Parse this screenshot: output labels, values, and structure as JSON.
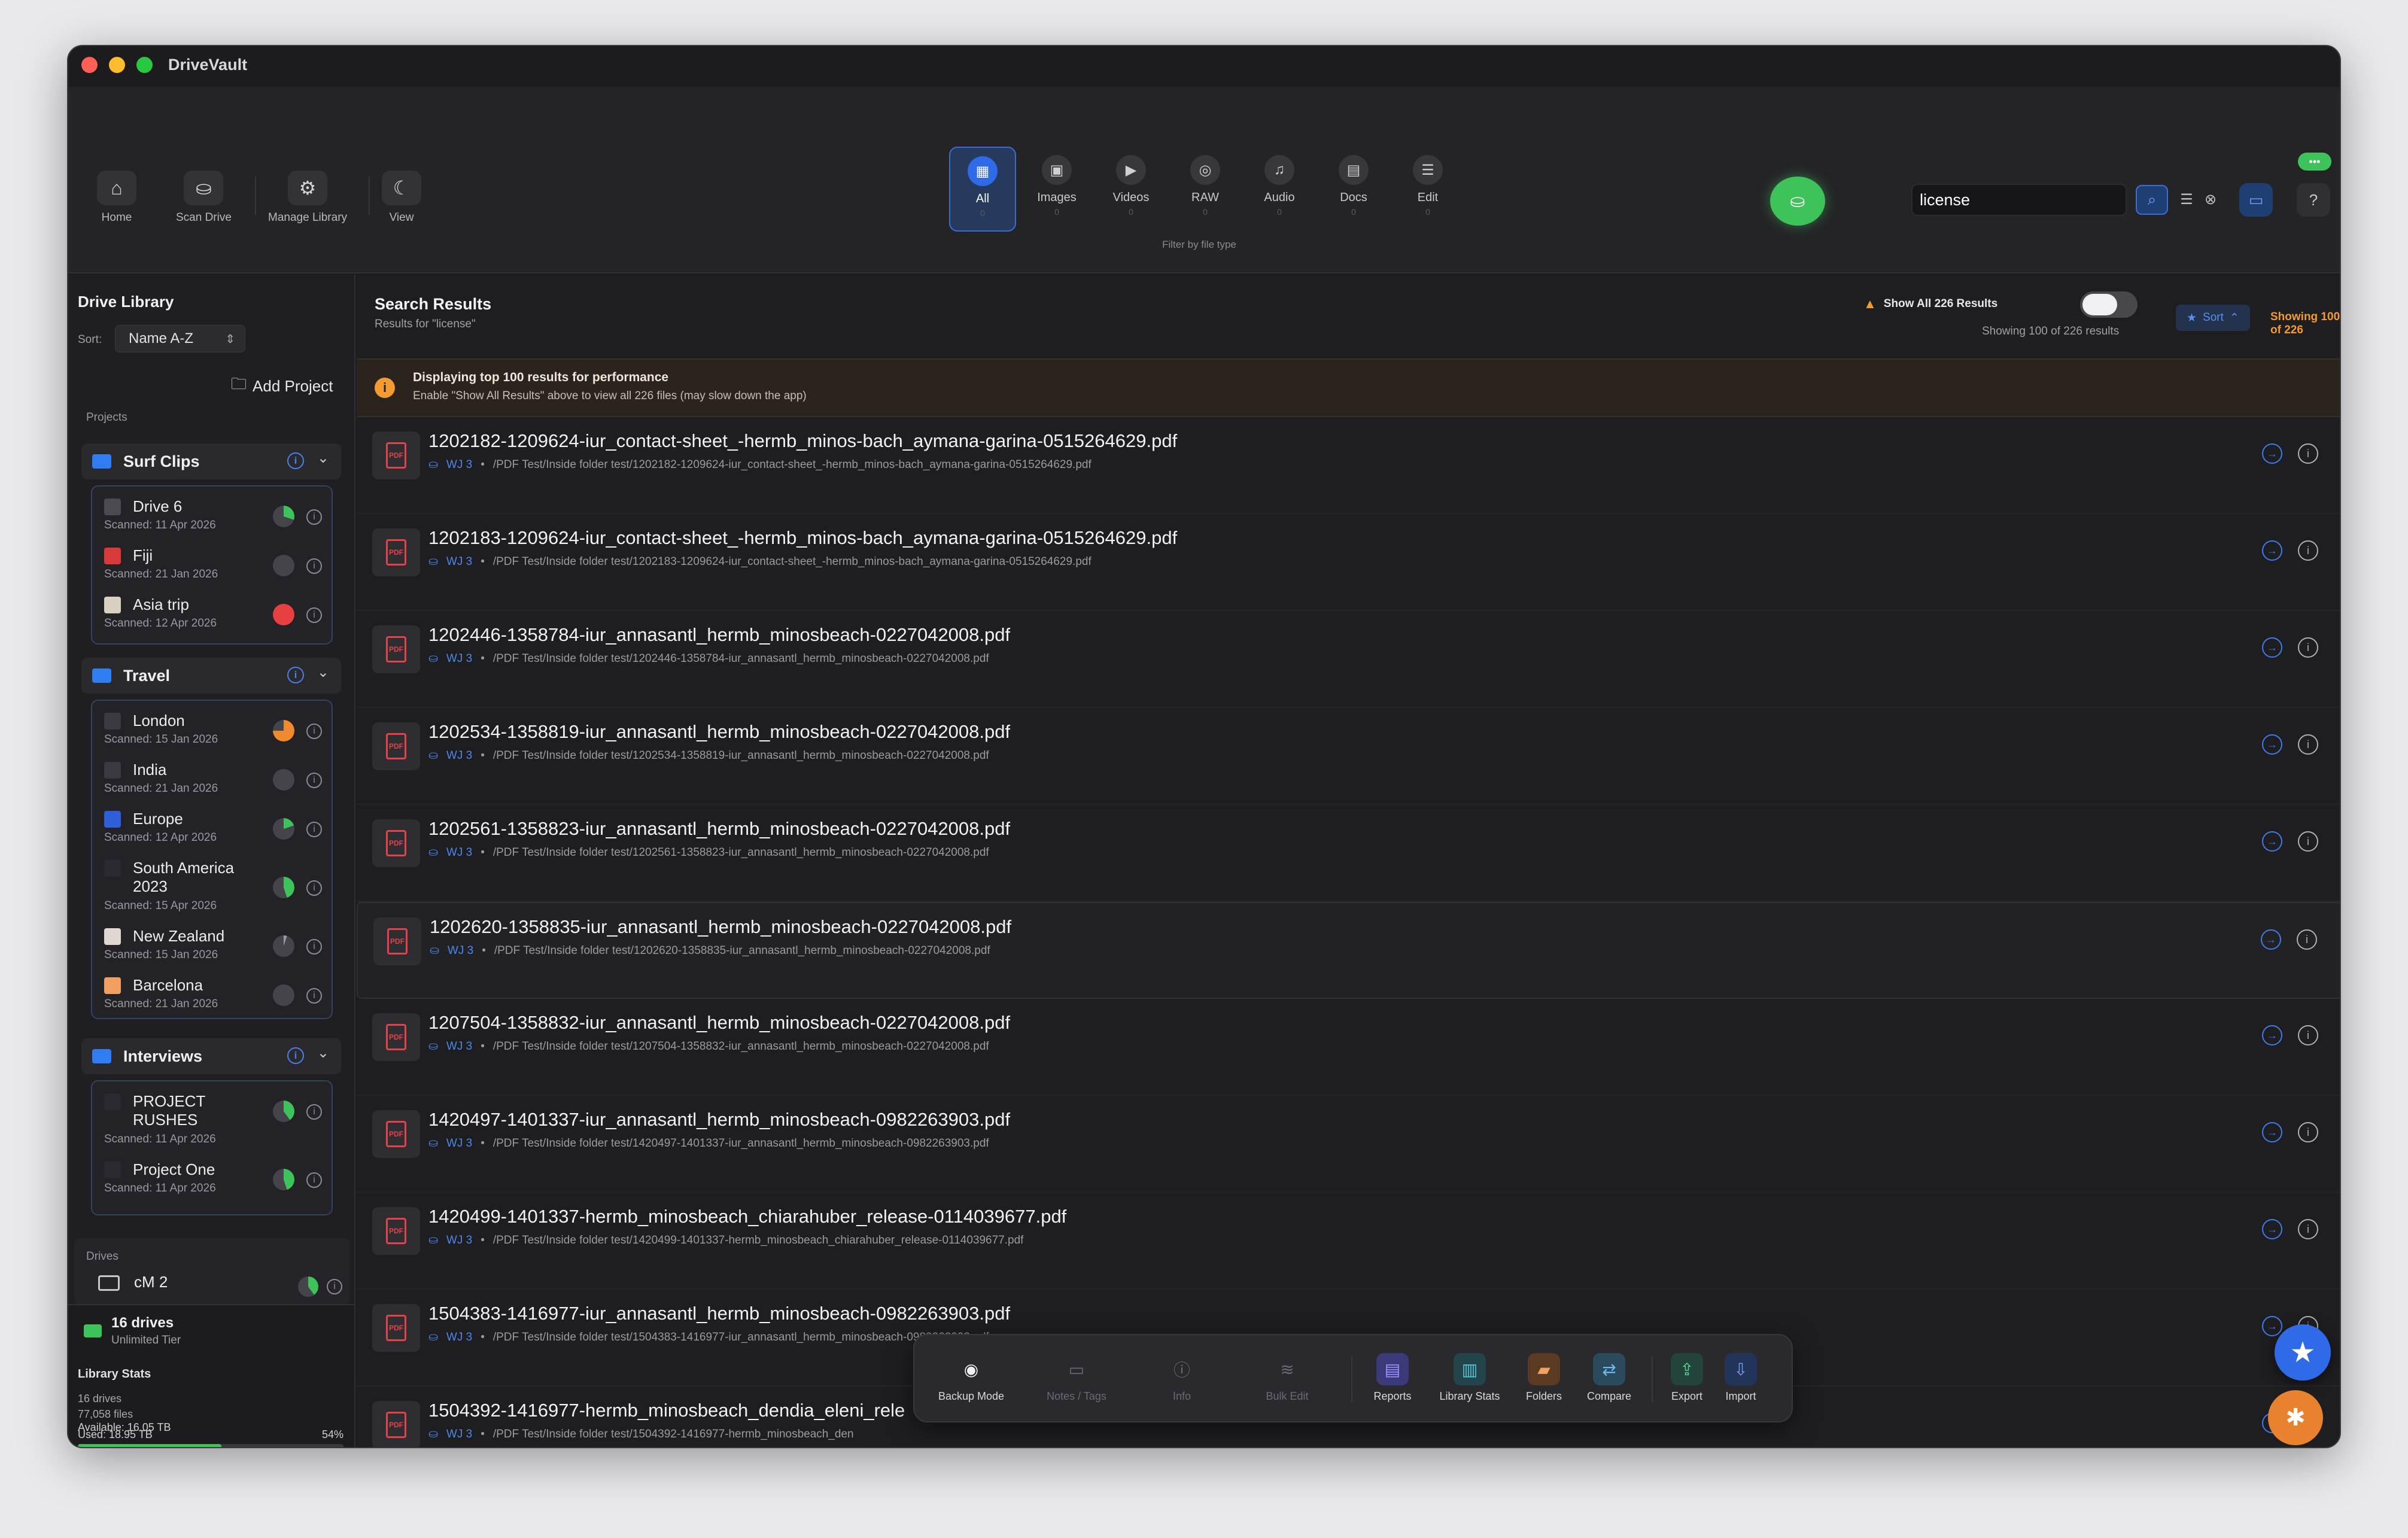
{
  "app": {
    "title": "DriveVault"
  },
  "toolbar": {
    "buttons": [
      {
        "label": "Home",
        "icon": "⌂"
      },
      {
        "label": "Scan Drive",
        "icon": "⛀"
      },
      {
        "label": "Manage Library",
        "icon": "⚙"
      },
      {
        "label": "View",
        "icon": "☾"
      }
    ],
    "file_types": [
      {
        "label": "All",
        "count": "0",
        "icon": "▦"
      },
      {
        "label": "Images",
        "count": "0",
        "icon": "▣"
      },
      {
        "label": "Videos",
        "count": "0",
        "icon": "▶"
      },
      {
        "label": "RAW",
        "count": "0",
        "icon": "◎"
      },
      {
        "label": "Audio",
        "count": "0",
        "icon": "♫"
      },
      {
        "label": "Docs",
        "count": "0",
        "icon": "▤"
      },
      {
        "label": "Edit",
        "count": "0",
        "icon": "☰"
      }
    ],
    "filter_caption": "Filter by file type",
    "search_value": "license",
    "status_pill": "•••"
  },
  "sidebar": {
    "title": "Drive Library",
    "sort_label": "Sort:",
    "sort_value": "Name A-Z",
    "add_project": "Add Project",
    "projects_label": "Projects",
    "projects": [
      {
        "name": "Surf Clips",
        "drives": [
          {
            "name": "Drive 6",
            "scanned": "Scanned: 11 Apr 2026"
          },
          {
            "name": "Fiji",
            "scanned": "Scanned: 21 Jan 2026"
          },
          {
            "name": "Asia trip",
            "scanned": "Scanned: 12 Apr 2026"
          }
        ]
      },
      {
        "name": "Travel",
        "drives": [
          {
            "name": "London",
            "scanned": "Scanned: 15 Jan 2026"
          },
          {
            "name": "India",
            "scanned": "Scanned: 21 Jan 2026"
          },
          {
            "name": "Europe",
            "scanned": "Scanned: 12 Apr 2026"
          },
          {
            "name": "South America 2023",
            "scanned": "Scanned: 15 Apr 2026"
          },
          {
            "name": "New Zealand",
            "scanned": "Scanned: 15 Jan 2026"
          },
          {
            "name": "Barcelona",
            "scanned": "Scanned: 21 Jan 2026"
          }
        ]
      },
      {
        "name": "Interviews",
        "drives": [
          {
            "name": "PROJECT RUSHES",
            "scanned": "Scanned: 11 Apr 2026"
          },
          {
            "name": "Project One",
            "scanned": "Scanned: 11 Apr 2026"
          }
        ]
      }
    ],
    "drives_label": "Drives",
    "drives_first": "cM 2",
    "footer": {
      "drives_count": "16 drives",
      "tier": "Unlimited Tier",
      "stats_title": "Library Stats",
      "stats_drives": "16 drives",
      "stats_files": "77,058 files",
      "used": "Used: 18.95 TB",
      "used_pct": "54%",
      "used_fraction": 0.54,
      "available": "Available: 16.05 TB"
    }
  },
  "main": {
    "title": "Search Results",
    "subtitle": "Results for \"license\"",
    "show_all_label": "Show All 226 Results",
    "showing_sub": "Showing 100 of 226 results",
    "sort_label": "Sort",
    "showing_badge": "Showing 100 of 226",
    "banner_title": "Displaying top 100 results for performance",
    "banner_text": "Enable \"Show All Results\" above to view all 226 files (may slow down the app)",
    "results": [
      {
        "name": "1202182-1209624-iur_contact-sheet_-hermb_minos-bach_aymana-garina-0515264629.pdf",
        "volume": "WJ 3",
        "path": "/PDF Test/Inside folder test/1202182-1209624-iur_contact-sheet_-hermb_minos-bach_aymana-garina-0515264629.pdf"
      },
      {
        "name": "1202183-1209624-iur_contact-sheet_-hermb_minos-bach_aymana-garina-0515264629.pdf",
        "volume": "WJ 3",
        "path": "/PDF Test/Inside folder test/1202183-1209624-iur_contact-sheet_-hermb_minos-bach_aymana-garina-0515264629.pdf"
      },
      {
        "name": "1202446-1358784-iur_annasantl_hermb_minosbeach-0227042008.pdf",
        "volume": "WJ 3",
        "path": "/PDF Test/Inside folder test/1202446-1358784-iur_annasantl_hermb_minosbeach-0227042008.pdf"
      },
      {
        "name": "1202534-1358819-iur_annasantl_hermb_minosbeach-0227042008.pdf",
        "volume": "WJ 3",
        "path": "/PDF Test/Inside folder test/1202534-1358819-iur_annasantl_hermb_minosbeach-0227042008.pdf"
      },
      {
        "name": "1202561-1358823-iur_annasantl_hermb_minosbeach-0227042008.pdf",
        "volume": "WJ 3",
        "path": "/PDF Test/Inside folder test/1202561-1358823-iur_annasantl_hermb_minosbeach-0227042008.pdf"
      },
      {
        "name": "1202620-1358835-iur_annasantl_hermb_minosbeach-0227042008.pdf",
        "volume": "WJ 3",
        "path": "/PDF Test/Inside folder test/1202620-1358835-iur_annasantl_hermb_minosbeach-0227042008.pdf"
      },
      {
        "name": "1207504-1358832-iur_annasantl_hermb_minosbeach-0227042008.pdf",
        "volume": "WJ 3",
        "path": "/PDF Test/Inside folder test/1207504-1358832-iur_annasantl_hermb_minosbeach-0227042008.pdf"
      },
      {
        "name": "1420497-1401337-iur_annasantl_hermb_minosbeach-0982263903.pdf",
        "volume": "WJ 3",
        "path": "/PDF Test/Inside folder test/1420497-1401337-iur_annasantl_hermb_minosbeach-0982263903.pdf"
      },
      {
        "name": "1420499-1401337-hermb_minosbeach_chiarahuber_release-0114039677.pdf",
        "volume": "WJ 3",
        "path": "/PDF Test/Inside folder test/1420499-1401337-hermb_minosbeach_chiarahuber_release-0114039677.pdf"
      },
      {
        "name": "1504383-1416977-iur_annasantl_hermb_minosbeach-0982263903.pdf",
        "volume": "WJ 3",
        "path": "/PDF Test/Inside folder test/1504383-1416977-iur_annasantl_hermb_minosbeach-0982263903.pdf"
      },
      {
        "name": "1504392-1416977-hermb_minosbeach_dendia_eleni_rele",
        "volume": "WJ 3",
        "path": "/PDF Test/Inside folder test/1504392-1416977-hermb_minosbeach_den"
      }
    ]
  },
  "bottom_bar": [
    {
      "label": "Backup Mode",
      "icon": "◉"
    },
    {
      "label": "Notes / Tags",
      "icon": "▭"
    },
    {
      "label": "Info",
      "icon": "ⓘ"
    },
    {
      "label": "Bulk Edit",
      "icon": "≋"
    },
    {
      "label": "Reports",
      "icon": "▤"
    },
    {
      "label": "Library Stats",
      "icon": "▥"
    },
    {
      "label": "Folders",
      "icon": "▰"
    },
    {
      "label": "Compare",
      "icon": "⇄"
    },
    {
      "label": "Export",
      "icon": "⇪"
    },
    {
      "label": "Import",
      "icon": "⇩"
    }
  ],
  "colors": {
    "accent": "#2f6be8",
    "green": "#3ec35a",
    "warning": "#f39a32",
    "pdf_red": "#e5434a"
  }
}
